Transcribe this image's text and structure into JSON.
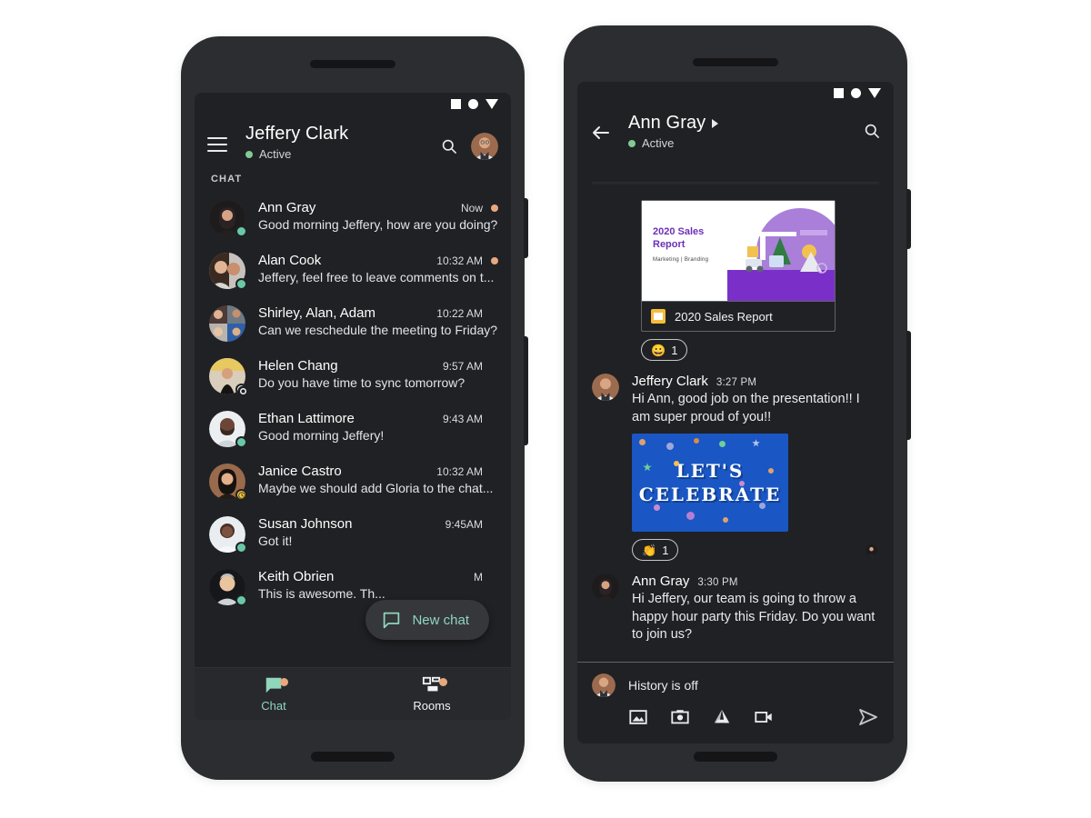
{
  "status_bar": {
    "icons": [
      "square-icon",
      "circle-icon",
      "triangle-down-icon"
    ]
  },
  "phone_left": {
    "header": {
      "menu_icon": "hamburger-menu-icon",
      "title": "Jeffery Clark",
      "presence": "Active",
      "search_icon": "search-icon",
      "avatar": "user-avatar"
    },
    "section_label": "CHAT",
    "chats": [
      {
        "name": "Ann Gray",
        "message": "Good morning Jeffery, how are you doing?",
        "time": "Now",
        "unread": true,
        "status": "online"
      },
      {
        "name": "Alan Cook",
        "message": "Jeffery, feel free to leave comments on t...",
        "time": "10:32 AM",
        "unread": true,
        "status": "online"
      },
      {
        "name": "Shirley, Alan, Adam",
        "message": "Can we reschedule the meeting to Friday?",
        "time": "10:22 AM",
        "unread": false,
        "status": "none"
      },
      {
        "name": "Helen Chang",
        "message": "Do you have time to sync tomorrow?",
        "time": "9:57 AM",
        "unread": false,
        "status": "camera"
      },
      {
        "name": "Ethan Lattimore",
        "message": "Good morning Jeffery!",
        "time": "9:43 AM",
        "unread": false,
        "status": "online"
      },
      {
        "name": "Janice Castro",
        "message": "Maybe we should add Gloria to the chat...",
        "time": "10:32 AM",
        "unread": false,
        "status": "away"
      },
      {
        "name": "Susan Johnson",
        "message": "Got it!",
        "time": "9:45AM",
        "unread": false,
        "status": "online"
      },
      {
        "name": "Keith Obrien",
        "message": "This is awesome. Th...",
        "time": "M",
        "unread": false,
        "status": "online"
      }
    ],
    "fab": {
      "icon": "new-chat-icon",
      "label": "New chat"
    },
    "bottom_nav": [
      {
        "label": "Chat",
        "icon": "chat-icon",
        "active": true,
        "badge": true
      },
      {
        "label": "Rooms",
        "icon": "rooms-icon",
        "active": false,
        "badge": true
      }
    ]
  },
  "phone_right": {
    "header": {
      "back_icon": "back-arrow-icon",
      "title": "Ann Gray",
      "title_caret": "caret-right-icon",
      "presence": "Active",
      "search_icon": "search-icon"
    },
    "attachment": {
      "doc_title_line1": "2020 Sales",
      "doc_title_line2": "Report",
      "doc_subtitle": "Marketing | Branding",
      "file_icon": "google-slides-icon",
      "file_name": "2020 Sales Report"
    },
    "reaction_doc": {
      "emoji": "😀",
      "count": "1"
    },
    "messages": [
      {
        "name": "Jeffery Clark",
        "time": "3:27 PM",
        "text": "Hi Ann, good job on the presentation!! I am super proud of you!!",
        "image_line1": "LET'S",
        "image_line2": "CELEBRATE",
        "reaction": {
          "emoji": "👏",
          "count": "1"
        }
      },
      {
        "name": "Ann Gray",
        "time": "3:30 PM",
        "text": "Hi Jeffery, our team is going to throw a happy hour party this Friday. Do you want to join us?"
      }
    ],
    "composer": {
      "avatar": "user-avatar",
      "hint": "History is off",
      "icons": [
        "image-icon",
        "camera-icon",
        "google-drive-icon",
        "video-icon"
      ],
      "send_icon": "send-icon"
    }
  },
  "colors": {
    "accent_mint": "#8fd6bd",
    "unread_dot": "#e8a87f",
    "online": "#68c9a6",
    "away": "#f7cb4d",
    "screen_bg": "#202124",
    "frame": "#2c2d30"
  }
}
